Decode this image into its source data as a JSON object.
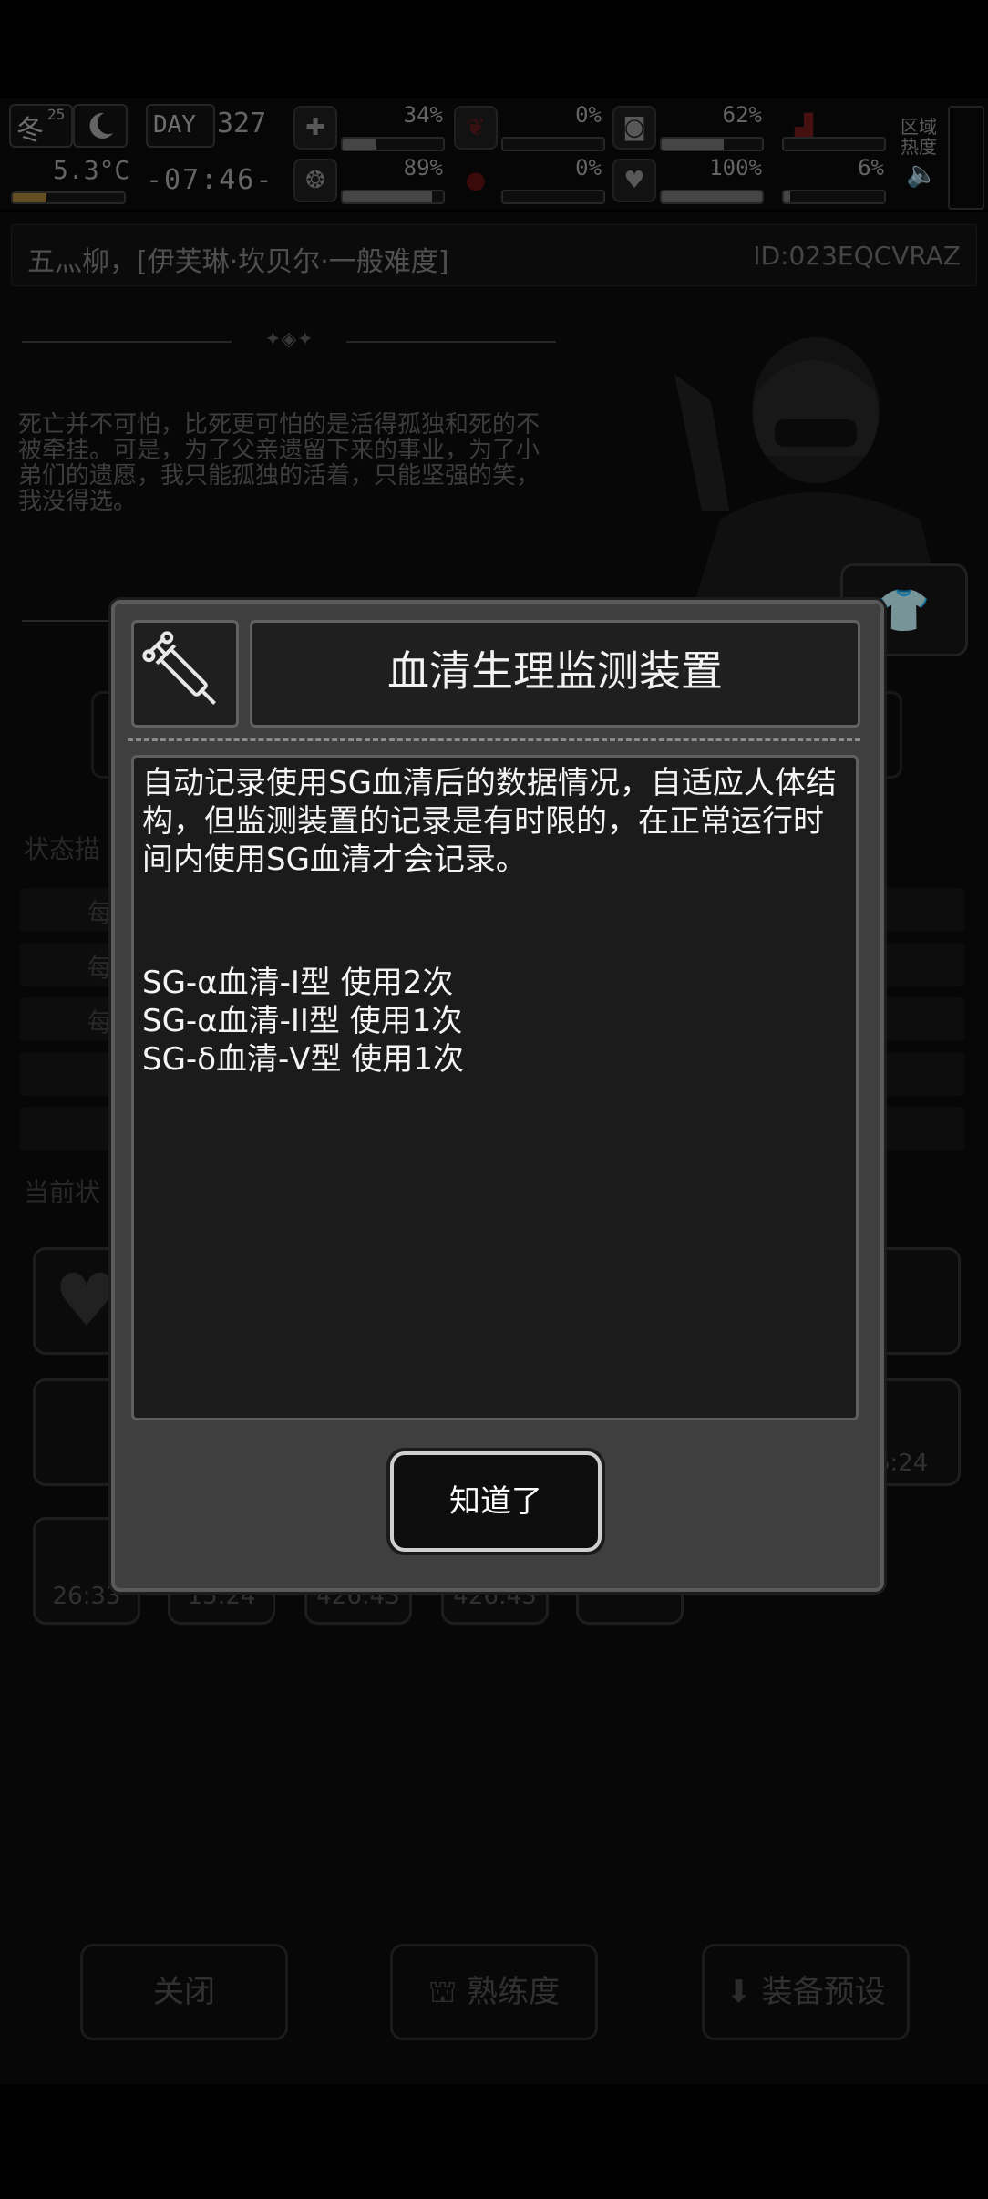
{
  "hud": {
    "season": "冬",
    "season_day": "25",
    "temperature": "5.3°C",
    "day_label": "DAY",
    "day_number": "327",
    "clock": "-07:46-",
    "zone_heat_label": "区域\n热度",
    "stats": [
      {
        "icon": "medkit-icon",
        "percent": "34%",
        "fill": 0.34
      },
      {
        "icon": "bird-icon",
        "percent": "0%",
        "fill": 0.0
      },
      {
        "icon": "stomach-icon",
        "percent": "62%",
        "fill": 0.62
      },
      {
        "icon": "boot-icon",
        "percent": "",
        "fill": 0.0
      },
      {
        "icon": "brain-icon",
        "percent": "89%",
        "fill": 0.89
      },
      {
        "icon": "blood-drop-icon",
        "percent": "0%",
        "fill": 0.0
      },
      {
        "icon": "heart-icon",
        "percent": "100%",
        "fill": 1.0
      },
      {
        "icon": "stamina-icon",
        "percent": "6%",
        "fill": 0.06
      }
    ]
  },
  "character": {
    "name_line": "五灬柳，[伊芙琳·坎贝尔·一般难度]",
    "id": "ID:023EQCVRAZ",
    "quote": "死亡并不可怕，比死更可怕的是活得孤独和死的不被牵挂。可是，为了父亲遗留下来的事业，为了小弟们的遗愿，我只能孤独的活着，只能坚强的笑，我没得选。"
  },
  "background_labels": {
    "status_desc": "状态描",
    "current_status": "当前状",
    "row_labels": [
      "每",
      "每",
      "每"
    ],
    "slot_times": [
      "26:33",
      "15:24",
      "426:43",
      "426:43",
      "6:24"
    ]
  },
  "bottom_buttons": {
    "close": "关闭",
    "proficiency": "熟练度",
    "equip_preset": "装备预设"
  },
  "dialog": {
    "title": "血清生理监测装置",
    "icon": "syringe-icon",
    "description": "自动记录使用SG血清后的数据情况，自适应人体结构，但监测装置的记录是有时限的，在正常运行时间内使用SG血清才会记录。",
    "log": [
      "SG-α血清-I型 使用2次",
      "SG-α血清-II型 使用1次",
      "SG-δ血清-V型 使用1次"
    ],
    "ok_button": "知道了"
  }
}
